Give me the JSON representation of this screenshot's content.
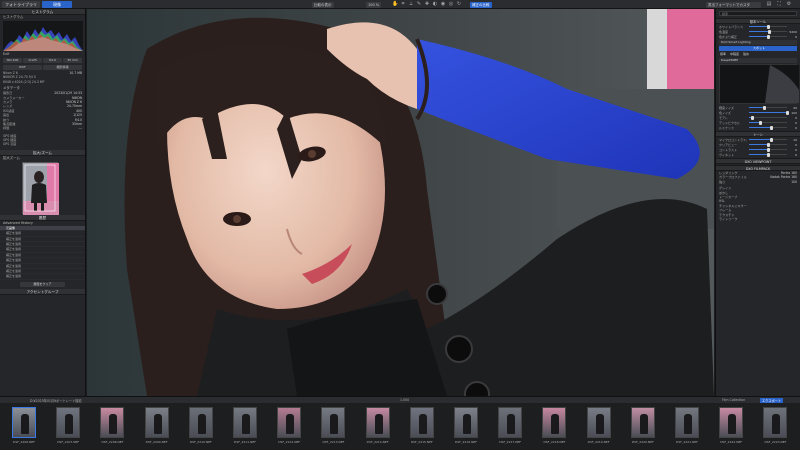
{
  "topbar": {
    "library_tab": "フォトライブラリ",
    "develop_tab": "現像",
    "export_label": "書出フォーマットでカスタ",
    "pills": [
      "比較の表示",
      "100 %",
      "倍率",
      "補正の比較"
    ]
  },
  "left": {
    "histogram_title": "ヒストグラム",
    "histogram_sub": "ヒストグラム",
    "histogram_mode": "ExIf",
    "btns_row1": [
      "ISO 400",
      "1/125",
      "f/4.0",
      "35 mm"
    ],
    "btns_row2": [
      "EXIF",
      "撮影情報"
    ],
    "info_rows": [
      {
        "k": "Nikon Z 6",
        "v": "10.7 MB"
      },
      {
        "k": "NIKKOR Z 24-70 f/4 S",
        "v": ""
      },
      {
        "k": "6048 x 4024 (2:3) 24.3 MP",
        "v": ""
      }
    ],
    "meta_title": "メタデータ",
    "meta_rows": [
      {
        "k": "撮影日",
        "v": "2023/01/29 14:33"
      },
      {
        "k": "カメラメーカー",
        "v": "NIKON"
      },
      {
        "k": "カメラ",
        "v": "NIKON Z 6"
      },
      {
        "k": "レンズ",
        "v": "24-70mm"
      },
      {
        "k": "ISO感度",
        "v": "400"
      },
      {
        "k": "露出",
        "v": "1/125"
      },
      {
        "k": "絞り",
        "v": "f/4.0"
      },
      {
        "k": "焦点距離",
        "v": "35mm"
      },
      {
        "k": "評価",
        "v": "---"
      }
    ],
    "gps_rows": [
      {
        "k": "GPS 緯度",
        "v": ""
      },
      {
        "k": "GPS 経度",
        "v": ""
      },
      {
        "k": "GPS 高度",
        "v": ""
      }
    ],
    "loupe_title": "拡大/ズーム",
    "loupe_label": "拡大ズーム",
    "history_title": "履歴",
    "history_mode": "Advanced History",
    "history_items": [
      "元画像",
      "補正を適用",
      "補正を適用",
      "補正を適用",
      "補正を適用",
      "補正を適用",
      "補正を適用",
      "補正を適用",
      "補正を適用",
      "補正を適用"
    ],
    "bottom_btn": "履歴をクリア",
    "footer": "アクセントグループ"
  },
  "right": {
    "search_placeholder": "検索",
    "section_basic": "基本ツール",
    "rows_top": [
      {
        "label": "ホワイトバランス",
        "num": "",
        "level": 0.5
      },
      {
        "label": "色温度",
        "num": "5200",
        "level": 0.55
      },
      {
        "label": "色かぶり補正",
        "num": "0",
        "level": 0.5
      }
    ],
    "preset_label": "DxO Smart Lighting",
    "mode_label": "スポット",
    "radio": [
      "標準",
      "中程度",
      "強め"
    ],
    "preset_blue": "DeepPRIME",
    "rows_mid": [
      {
        "label": "輝度ノイズ",
        "num": "40",
        "level": 0.4
      },
      {
        "label": "色ノイズ",
        "num": "100",
        "level": 1.0
      },
      {
        "label": "モアレ",
        "num": "0",
        "level": 0.1
      },
      {
        "label": "デッドピクセル",
        "num": "0",
        "level": 0.3
      },
      {
        "label": "ルミナンス",
        "num": "0",
        "level": 0.6
      }
    ],
    "section_tone": "トーン",
    "rows_tone": [
      {
        "label": "マイクロコントラスト",
        "num": "10",
        "level": 0.6
      },
      {
        "label": "クリアビュー",
        "num": "0",
        "level": 0.5
      },
      {
        "label": "コントラスト",
        "num": "0",
        "level": 0.5
      },
      {
        "label": "ヴィネット",
        "num": "0",
        "level": 0.5
      }
    ],
    "section_view": "DXO VIEWPOINT",
    "section_film": "DXO FILMPACK",
    "film_rows": [
      {
        "k": "レンダリング",
        "v": "Portra 160"
      },
      {
        "k": "カラープロファイル",
        "v": "Kodak Portra 160"
      },
      {
        "k": "強さ",
        "v": "100"
      }
    ],
    "lower_rows": [
      "グレイン",
      "ぼかし",
      "トーンカーブ",
      "HSL",
      "チャンネルミキサー",
      "フレーム",
      "テクスチャ",
      "ライトリーク"
    ]
  },
  "filmbar": {
    "path": "D:¥2023年01月¥ポートレート撮影",
    "count": "1,000",
    "collection": "Film Collection",
    "export_btn": "エクスポート"
  },
  "filmstrip": [
    {
      "name": "DSF_2206.NEF",
      "tone": "#8a8f98"
    },
    {
      "name": "DSF_2207.NEF",
      "tone": "#6f7480"
    },
    {
      "name": "DSF_2208.NEF",
      "tone": "#c98aa0"
    },
    {
      "name": "DSF_2209.NEF",
      "tone": "#7b7f88"
    },
    {
      "name": "DSF_2210.NEF",
      "tone": "#6a6e76"
    },
    {
      "name": "DSF_2211.NEF",
      "tone": "#757982"
    },
    {
      "name": "DSF_2212.NEF",
      "tone": "#b47b92"
    },
    {
      "name": "DSF_2213.NEF",
      "tone": "#767a83"
    },
    {
      "name": "DSF_2214.NEF",
      "tone": "#c48aa2"
    },
    {
      "name": "DSF_2215.NEF",
      "tone": "#707480"
    },
    {
      "name": "DSF_2216.NEF",
      "tone": "#7d818a"
    },
    {
      "name": "DSF_2217.NEF",
      "tone": "#6c7079"
    },
    {
      "name": "DSF_2218.NEF",
      "tone": "#c6879f"
    },
    {
      "name": "DSF_2219.NEF",
      "tone": "#787c85"
    },
    {
      "name": "DSF_2220.NEF",
      "tone": "#c08ea3"
    },
    {
      "name": "DSF_2221.NEF",
      "tone": "#737780"
    },
    {
      "name": "DSF_2222.NEF",
      "tone": "#c78aa3"
    },
    {
      "name": "DSF_2223.NEF",
      "tone": "#6e727b"
    }
  ]
}
